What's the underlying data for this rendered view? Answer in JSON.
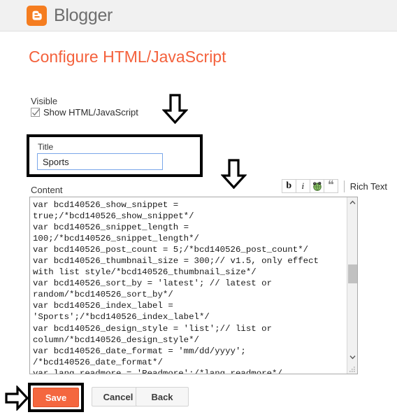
{
  "header": {
    "logo_icon": "blogger-b-icon",
    "wordmark": "Blogger",
    "logo_color": "#f57d20",
    "background": "#f1f1f1"
  },
  "page": {
    "title": "Configure HTML/JavaScript",
    "title_color": "#f4613c"
  },
  "visible_section": {
    "label": "Visible",
    "checkbox_label": "Show HTML/JavaScript",
    "checked": true
  },
  "title_field": {
    "label": "Title",
    "value": "Sports",
    "placeholder": ""
  },
  "content_section": {
    "label": "Content",
    "value": "var bcd140526_show_snippet = true;/*bcd140526_show_snippet*/\nvar bcd140526_snippet_length = 100;/*bcd140526_snippet_length*/\nvar bcd140526_post_count = 5;/*bcd140526_post_count*/\nvar bcd140526_thumbnail_size = 300;// v1.5, only effect with list style/*bcd140526_thumbnail_size*/\nvar bcd140526_sort_by = 'latest'; // latest or random/*bcd140526_sort_by*/\nvar bcd140526_index_label = 'Sports';/*bcd140526_index_label*/\nvar bcd140526_design_style = 'list';// list or column/*bcd140526_design_style*/\nvar bcd140526_date_format = 'mm/dd/yyyy'; /*bcd140526_date_format*/\nvar lang_readmore = 'Readmore';/*lang_readmore*/\nvar lang_host = ''; /*lang_host*/"
  },
  "toolbar": {
    "bold_label": "b",
    "italic_label": "i",
    "link_icon": "green-globe-link-icon",
    "quote_label": "❝",
    "rich_text_label": "Rich Text"
  },
  "buttons": {
    "save_label": "Save",
    "save_color": "#f4673f",
    "cancel_label": "Cancel",
    "back_label": "Back"
  },
  "annotations": {
    "arrow_down_visible": "down-arrow-annotation",
    "arrow_down_toolbar": "down-arrow-annotation",
    "arrow_right_save": "right-arrow-annotation",
    "box_title": "highlight-box-annotation",
    "box_save": "highlight-box-annotation",
    "color": "#000000"
  }
}
